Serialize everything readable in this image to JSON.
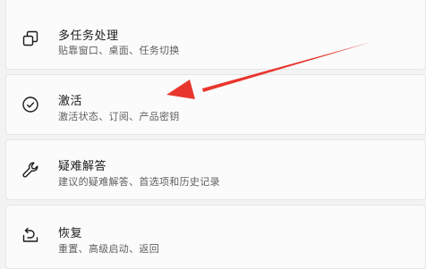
{
  "settings": {
    "items": [
      {
        "title": "多任务处理",
        "subtitle": "贴靠窗口、桌面、任务切换",
        "icon": "multitasking-icon"
      },
      {
        "title": "激活",
        "subtitle": "激活状态、订阅、产品密钥",
        "icon": "check-circle-icon"
      },
      {
        "title": "疑难解答",
        "subtitle": "建议的疑难解答、首选项和历史记录",
        "icon": "wrench-icon"
      },
      {
        "title": "恢复",
        "subtitle": "重置、高级启动、返回",
        "icon": "recovery-icon"
      }
    ]
  },
  "annotation": {
    "color": "#e8362d"
  }
}
